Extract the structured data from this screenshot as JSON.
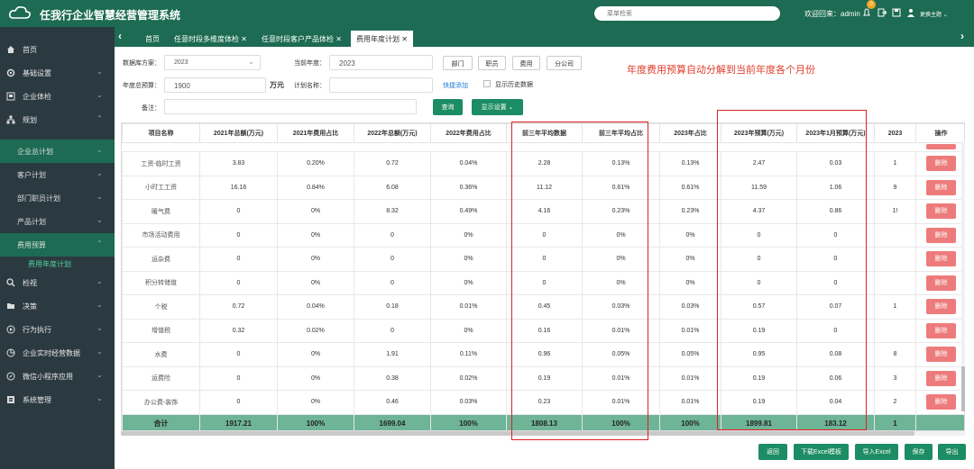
{
  "app": {
    "title": "任我行企业智慧经营管理系统",
    "search_placeholder": "菜单检索",
    "welcome": "欢迎回来：admin",
    "notif_count": "0",
    "theme": "更换主题"
  },
  "sidebar": [
    {
      "label": "首页",
      "icon": "home-icon"
    },
    {
      "label": "基础设置",
      "icon": "gear-icon"
    },
    {
      "label": "企业体检",
      "icon": "building-icon"
    },
    {
      "label": "规划",
      "icon": "sitemap-icon"
    }
  ],
  "sidebar_sub": [
    {
      "label": "企业总计划"
    },
    {
      "label": "客户计划"
    },
    {
      "label": "部门职员计划"
    },
    {
      "label": "产品计划"
    },
    {
      "label": "费用预算"
    }
  ],
  "sidebar_leaf": "费用年度计划",
  "sidebar_more": [
    {
      "label": "检视",
      "icon": "search-icon"
    },
    {
      "label": "决策",
      "icon": "folder-icon"
    },
    {
      "label": "行为执行",
      "icon": "run-icon"
    },
    {
      "label": "企业实时经营数据",
      "icon": "chart-icon"
    },
    {
      "label": "微信小程序应用",
      "icon": "compass-icon"
    },
    {
      "label": "系统管理",
      "icon": "list-icon"
    }
  ],
  "tabs": [
    "首页",
    "任意时段多维度体检",
    "任意时段客户产品体检",
    "费用年度计划"
  ],
  "form": {
    "scheme_label": "数据库方案：",
    "scheme_value": "2023",
    "year_label": "当前年度：",
    "year_value": "2023",
    "btn_dept": "部门",
    "btn_staff": "职员",
    "btn_fee": "费用",
    "btn_branch": "分公司",
    "budget_label": "年度总预算：",
    "budget_value": "1900",
    "unit": "万元",
    "plan_label": "计划名称：",
    "quick_add": "快捷添加",
    "show_history": "显示历史数据",
    "remark_label": "备注：",
    "query": "查询",
    "display_settings": "显示设置"
  },
  "note": "年度费用预算自动分解到当前年度各个月份",
  "table": {
    "headers": [
      "项目名称",
      "2021年总额(万元)",
      "2021年费用占比",
      "2022年总额(万元)",
      "2022年费用占比",
      "前三年平均数据",
      "前三年平均占比",
      "2023年占比",
      "2023年预算(万元)",
      "2023年1月预算(万元)",
      "2023",
      "操作"
    ],
    "rows": [
      [
        "工资-临时工资",
        "3.83",
        "0.20%",
        "0.72",
        "0.04%",
        "2.28",
        "0.13%",
        "0.13%",
        "2.47",
        "0.03",
        "1",
        "删除"
      ],
      [
        "小时工工资",
        "16.16",
        "0.84%",
        "6.08",
        "0.36%",
        "11.12",
        "0.61%",
        "0.61%",
        "11.59",
        "1.06",
        "9",
        "删除"
      ],
      [
        "暖气费",
        "0",
        "0%",
        "8.32",
        "0.49%",
        "4.16",
        "0.23%",
        "0.23%",
        "4.37",
        "0.86",
        "1!",
        "删除"
      ],
      [
        "市场活动费用",
        "0",
        "0%",
        "0",
        "0%",
        "0",
        "0%",
        "0%",
        "0",
        "0",
        "",
        "删除"
      ],
      [
        "运杂费",
        "0",
        "0%",
        "0",
        "0%",
        "0",
        "0%",
        "0%",
        "0",
        "0",
        "",
        "删除"
      ],
      [
        "积分转储值",
        "0",
        "0%",
        "0",
        "0%",
        "0",
        "0%",
        "0%",
        "0",
        "0",
        "",
        "删除"
      ],
      [
        "个税",
        "0.72",
        "0.04%",
        "0.18",
        "0.01%",
        "0.45",
        "0.03%",
        "0.03%",
        "0.57",
        "0.07",
        "1",
        "删除"
      ],
      [
        "增值税",
        "0.32",
        "0.02%",
        "0",
        "0%",
        "0.16",
        "0.01%",
        "0.01%",
        "0.19",
        "0",
        "",
        "删除"
      ],
      [
        "水费",
        "0",
        "0%",
        "1.91",
        "0.11%",
        "0.96",
        "0.05%",
        "0.05%",
        "0.95",
        "0.08",
        "8",
        "删除"
      ],
      [
        "运费险",
        "0",
        "0%",
        "0.38",
        "0.02%",
        "0.19",
        "0.01%",
        "0.01%",
        "0.19",
        "0.06",
        "3",
        "删除"
      ],
      [
        "办公费-装饰",
        "0",
        "0%",
        "0.46",
        "0.03%",
        "0.23",
        "0.01%",
        "0.01%",
        "0.19",
        "0.04",
        "2",
        "删除"
      ]
    ],
    "total": [
      "合计",
      "1917.21",
      "100%",
      "1699.04",
      "100%",
      "1808.13",
      "100%",
      "100%",
      "1899.81",
      "183.12",
      "1",
      ""
    ]
  },
  "footer": [
    "返回",
    "下载Excel模板",
    "导入Excel",
    "保存",
    "导出"
  ]
}
